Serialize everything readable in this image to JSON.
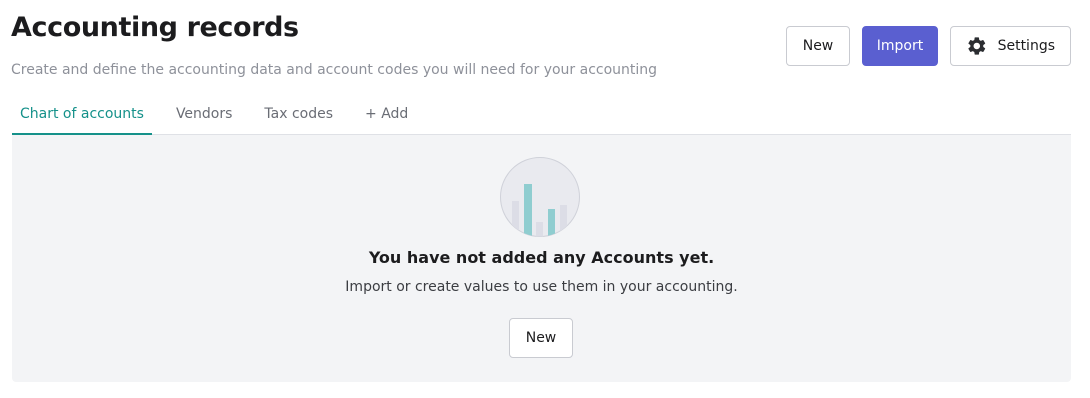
{
  "header": {
    "title": "Accounting records",
    "subtitle": "Create and define the accounting data and account codes you will need for your accounting"
  },
  "actions": {
    "new_label": "New",
    "import_label": "Import",
    "settings_label": "Settings",
    "settings_icon": "gear-icon"
  },
  "tabs": [
    {
      "label": "Chart of accounts",
      "active": true
    },
    {
      "label": "Vendors",
      "active": false
    },
    {
      "label": "Tax codes",
      "active": false
    },
    {
      "label": "+ Add",
      "active": false
    }
  ],
  "empty_state": {
    "illustration": "bar-chart-illustration",
    "heading": "You have not added any Accounts yet.",
    "description": "Import or create values to use them in your accounting.",
    "button_label": "New"
  },
  "colors": {
    "primary": "#5a5fd0",
    "active_tab": "#15918a",
    "panel_bg": "#f3f4f6",
    "chart_bar_accent": "#8fcdd0",
    "chart_bar_muted": "#dfe0e8"
  }
}
